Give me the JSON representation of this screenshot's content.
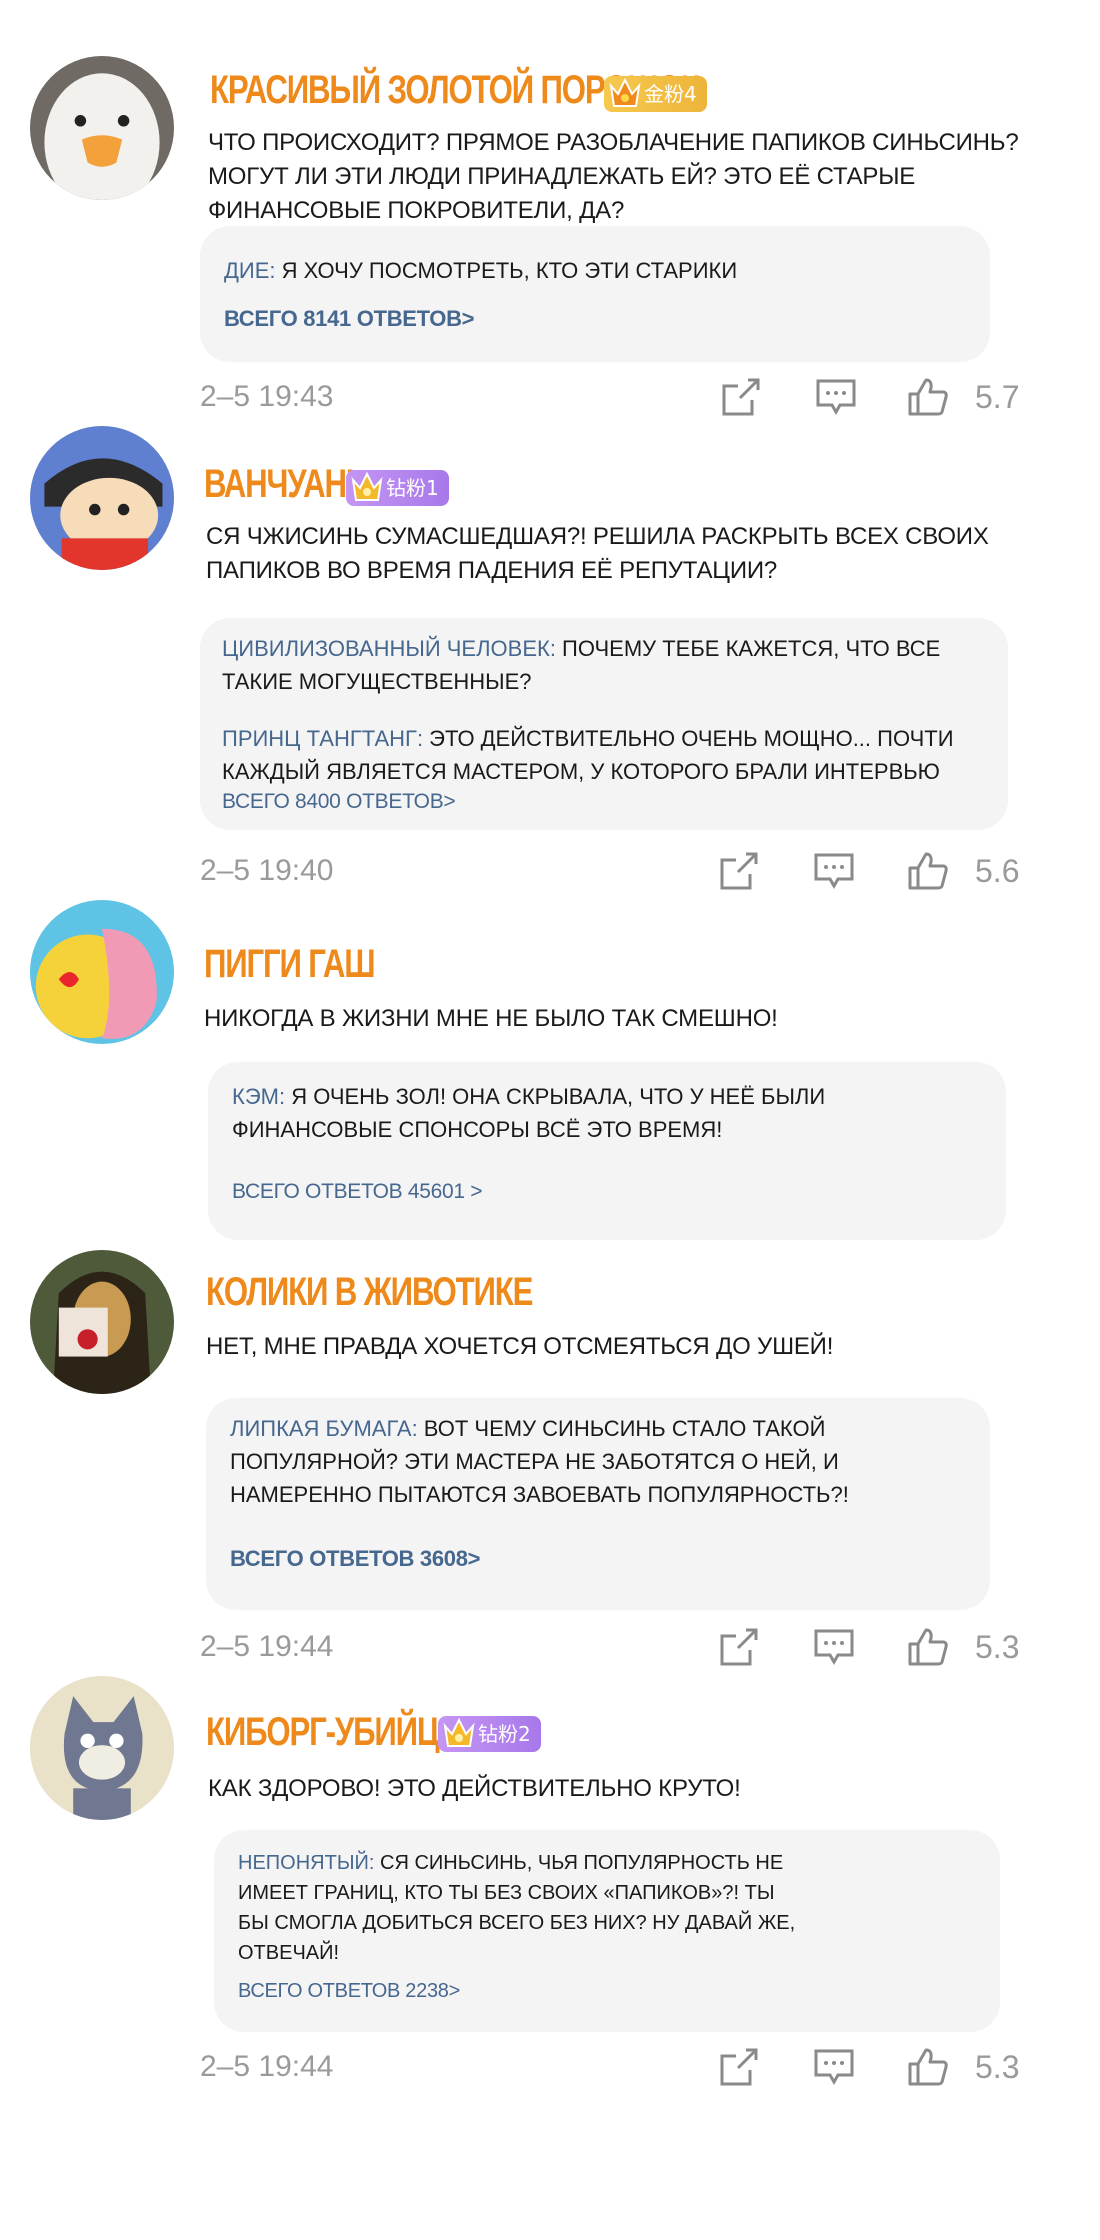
{
  "comments": [
    {
      "username": "КРАСИВЫЙ ЗОЛОТОЙ ПОРОШОК",
      "badge": "金粉4",
      "badge_color": "#f2bd45",
      "text": "ЧТО ПРОИСХОДИТ? ПРЯМОЕ РАЗОБЛАЧЕНИЕ ПАПИКОВ СИНЬСИНЬ? МОГУТ ЛИ ЭТИ ЛЮДИ ПРИНАДЛЕЖАТЬ ЕЙ? ЭТО ЕЁ СТАРЫЕ ФИНАНСОВЫЕ ПОКРОВИТЕЛИ, ДА?",
      "replies": [
        {
          "name": "ДИЕ:",
          "text": " Я ХОЧУ ПОСМОТРЕТЬ, КТО ЭТИ СТАРИКИ"
        }
      ],
      "total": "ВСЕГО  8141 ОТВЕТОВ>",
      "time": "2–5 19:43",
      "likes": "5.7",
      "avatar": "duck-avatar"
    },
    {
      "username": "ВАНЧУАНЬ",
      "badge": "钻粉1",
      "badge_color": "#b688ef",
      "text": "СЯ ЧЖИСИНЬ СУМАСШЕДШАЯ?! РЕШИЛА РАСКРЫТЬ ВСЕХ СВОИХ ПАПИКОВ ВО ВРЕМЯ ПАДЕНИЯ ЕЁ РЕПУТАЦИИ?",
      "replies": [
        {
          "name": "ЦИВИЛИЗОВАННЫЙ ЧЕЛОВЕК:",
          "text": " ПОЧЕМУ ТЕБЕ КАЖЕТСЯ, ЧТО ВСЕ ТАКИЕ МОГУЩЕСТВЕННЫЕ?"
        },
        {
          "name": "ПРИНЦ ТАНГТАНГ:",
          "text": " ЭТО ДЕЙСТВИТЕЛЬНО ОЧЕНЬ МОЩНО... ПОЧТИ КАЖДЫЙ ЯВЛЯЕТСЯ МАСТЕРОМ, У КОТОРОГО БРАЛИ ИНТЕРВЬЮ"
        }
      ],
      "total": "ВСЕГО 8400 ОТВЕТОВ>",
      "time": "2–5 19:40",
      "likes": "5.6",
      "avatar": "cartoon-boy-avatar"
    },
    {
      "username": "ПИГГИ ГАШ",
      "text": "НИКОГДА В ЖИЗНИ МНЕ НЕ БЫЛО ТАК СМЕШНО!",
      "replies": [
        {
          "name": "КЭМ:",
          "text": " Я ОЧЕНЬ ЗОЛ! ОНА СКРЫВАЛА, ЧТО У НЕЁ БЫЛИ ФИНАНСОВЫЕ СПОНСОРЫ ВСЁ ЭТО ВРЕМЯ!"
        }
      ],
      "total": "ВСЕГО ОТВЕТОВ 45601 >",
      "avatar": "pink-creature-avatar"
    },
    {
      "username": "КОЛИКИ В ЖИВОТИКЕ",
      "text": "НЕТ, МНЕ ПРАВДА ХОЧЕТСЯ ОТСМЕЯТЬСЯ ДО УШЕЙ!",
      "replies": [
        {
          "name": "ЛИПКАЯ БУМАГА:",
          "text": " ВОТ ЧЕМУ СИНЬСИНЬ СТАЛО ТАКОЙ ПОПУЛЯРНОЙ? ЭТИ МАСТЕРА НЕ ЗАБОТЯТСЯ О НЕЙ,  И НАМЕРЕННО ПЫТАЮТСЯ ЗАВОЕВАТЬ ПОПУЛЯРНОСТЬ?!"
        }
      ],
      "total": "ВСЕГО ОТВЕТОВ 3608>",
      "time": "2–5 19:44",
      "likes": "5.3",
      "avatar": "mona-lisa-avatar"
    },
    {
      "username": "КИБОРГ-УБИЙЦА",
      "badge": "钻粉2",
      "badge_color": "#b688ef",
      "text": "КАК ЗДОРОВО! ЭТО ДЕЙСТВИТЕЛЬНО КРУТО!",
      "replies": [
        {
          "name": "НЕПОНЯТЫЙ:",
          "text": " СЯ СИНЬСИНЬ, ЧЬЯ ПОПУЛЯРНОСТЬ НЕ ИМЕЕТ ГРАНИЦ, КТО ТЫ БЕЗ СВОИХ «ПАПИКОВ»?! ТЫ БЫ СМОГЛА ДОБИТЬСЯ ВСЕГО БЕЗ НИХ? НУ ДАВАЙ ЖЕ, ОТВЕЧАЙ!"
        }
      ],
      "total": "ВСЕГО ОТВЕТОВ 2238>",
      "time": "2–5 19:44",
      "likes": "5.3",
      "avatar": "cat-avatar"
    }
  ],
  "icons": {
    "share": "share-icon",
    "comment": "comment-icon",
    "like": "thumbs-up-icon"
  },
  "colors": {
    "username": "#ee8a1c",
    "reply_name": "#46678e",
    "reply_bg": "#f4f4f5",
    "meta": "#9a9a9a"
  }
}
